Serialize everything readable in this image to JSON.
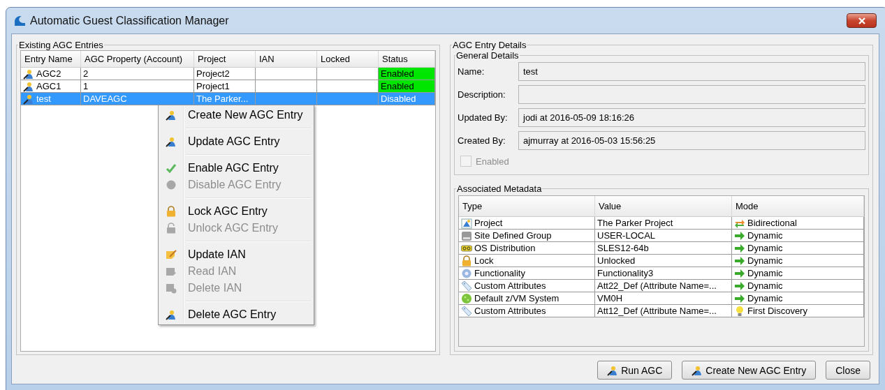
{
  "window": {
    "title": "Automatic Guest Classification Manager"
  },
  "entries": {
    "title": "Existing AGC Entries",
    "columns": [
      "Entry Name",
      "AGC Property (Account)",
      "Project",
      "IAN",
      "Locked",
      "Status"
    ],
    "rows": [
      {
        "name": "AGC2",
        "property": "2",
        "project": "Project2",
        "status": "Enabled",
        "enabled": true,
        "selected": false
      },
      {
        "name": "AGC1",
        "property": "1",
        "project": "Project1",
        "status": "Enabled",
        "enabled": true,
        "selected": false
      },
      {
        "name": "test",
        "property": "DAVEAGC",
        "project": "The Parker...",
        "status": "Disabled",
        "enabled": false,
        "selected": true
      }
    ]
  },
  "context_menu": {
    "groups": [
      {
        "items": [
          {
            "label": "Create New AGC Entry",
            "disabled": false
          }
        ]
      },
      {
        "items": [
          {
            "label": "Update AGC Entry",
            "disabled": false
          }
        ]
      },
      {
        "items": [
          {
            "label": "Enable AGC Entry",
            "disabled": false
          },
          {
            "label": "Disable AGC Entry",
            "disabled": true
          }
        ]
      },
      {
        "items": [
          {
            "label": "Lock AGC Entry",
            "disabled": false
          },
          {
            "label": "Unlock AGC Entry",
            "disabled": true
          }
        ]
      },
      {
        "items": [
          {
            "label": "Update IAN",
            "disabled": false
          },
          {
            "label": "Read IAN",
            "disabled": true
          },
          {
            "label": "Delete IAN",
            "disabled": true
          }
        ]
      },
      {
        "items": [
          {
            "label": "Delete AGC Entry",
            "disabled": false
          }
        ]
      }
    ]
  },
  "details": {
    "title": "AGC Entry Details",
    "general": {
      "title": "General Details",
      "fields": [
        {
          "label": "Name:",
          "value": "test"
        },
        {
          "label": "Description:"
        },
        {
          "label": "Updated By:",
          "value": "jodi at 2016-05-09 18:16:26"
        },
        {
          "label": "Created By:",
          "value": "ajmurray at 2016-05-03 15:56:25"
        }
      ],
      "enabled_checkbox": {
        "label": "Enabled",
        "checked": false,
        "disabled": true
      }
    },
    "metadata": {
      "title": "Associated Metadata",
      "columns": [
        "Type",
        "Value",
        "Mode"
      ],
      "rows": [
        {
          "type": "Project",
          "value": "The Parker Project",
          "mode": "Bidirectional",
          "kind": "bidirectional"
        },
        {
          "type": "Site Defined Group",
          "value": "USER-LOCAL",
          "mode": "Dynamic",
          "kind": "dynamic"
        },
        {
          "type": "OS Distribution",
          "value": "SLES12-64b",
          "mode": "Dynamic",
          "kind": "dynamic"
        },
        {
          "type": "Lock",
          "value": "Unlocked",
          "mode": "Dynamic",
          "kind": "dynamic"
        },
        {
          "type": "Functionality",
          "value": "Functionality3",
          "mode": "Dynamic",
          "kind": "dynamic"
        },
        {
          "type": "Custom Attributes",
          "value": "Att22_Def (Attribute Name=...",
          "mode": "Dynamic",
          "kind": "dynamic"
        },
        {
          "type": "Default z/VM System",
          "value": "VM0H",
          "mode": "Dynamic",
          "kind": "dynamic"
        },
        {
          "type": "Custom Attributes",
          "value": "Att12_Def (Attribute Name=...",
          "mode": "First Discovery",
          "kind": "discovery"
        }
      ]
    }
  },
  "buttons": [
    {
      "label": "Run AGC",
      "kind": "run"
    },
    {
      "label": "Create New AGC Entry",
      "kind": "create"
    },
    {
      "label": "Close",
      "kind": "plain"
    }
  ]
}
